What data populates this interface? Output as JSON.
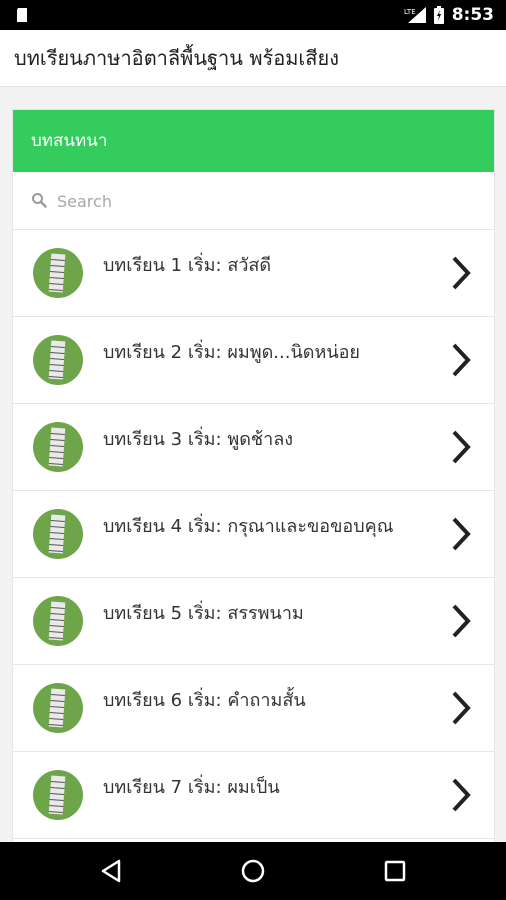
{
  "status_bar": {
    "time": "8:53",
    "network": "LTE",
    "icons": [
      "storage-icon",
      "signal-icon",
      "battery-icon"
    ]
  },
  "app_bar": {
    "title": "บทเรียนภาษาอิตาลีพื้นฐาน พร้อมเสียง"
  },
  "card": {
    "header": "บทสนทนา",
    "search_placeholder": "Search",
    "items": [
      {
        "label": "บทเรียน 1 เริ่ม: สวัสดี"
      },
      {
        "label": "บทเรียน 2 เริ่ม: ผมพูด...นิดหน่อย"
      },
      {
        "label": "บทเรียน 3 เริ่ม: พูดช้าลง"
      },
      {
        "label": "บทเรียน 4 เริ่ม: กรุณาและขอขอบคุณ"
      },
      {
        "label": "บทเรียน 5 เริ่ม: สรรพนาม"
      },
      {
        "label": "บทเรียน 6 เริ่ม: คำถามสั้น"
      },
      {
        "label": "บทเรียน 7 เริ่ม: ผมเป็น"
      }
    ]
  },
  "colors": {
    "header_green": "#33cc5d",
    "avatar_green": "#6fa54a"
  },
  "nav_bar": {
    "icons": [
      "back-icon",
      "home-icon",
      "recents-icon"
    ]
  }
}
